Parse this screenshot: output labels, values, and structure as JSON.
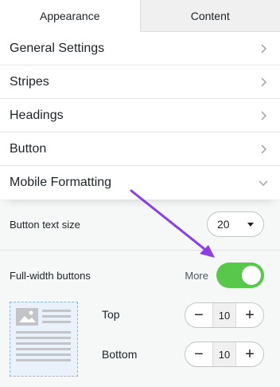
{
  "tabs": [
    {
      "label": "Appearance",
      "active": true
    },
    {
      "label": "Content",
      "active": false
    }
  ],
  "sections": [
    {
      "label": "General Settings",
      "state": "collapsed"
    },
    {
      "label": "Stripes",
      "state": "collapsed"
    },
    {
      "label": "Headings",
      "state": "collapsed"
    },
    {
      "label": "Button",
      "state": "collapsed"
    },
    {
      "label": "Mobile Formatting",
      "state": "expanded"
    }
  ],
  "mobile": {
    "button_text_size": {
      "label": "Button text size",
      "value": "20"
    },
    "full_width": {
      "label": "Full-width buttons",
      "more_label": "More",
      "enabled": true
    },
    "padding": {
      "top": {
        "label": "Top",
        "value": "10"
      },
      "bottom": {
        "label": "Bottom",
        "value": "10"
      }
    }
  },
  "icons": {
    "collapsed": "chevron-right-icon",
    "expanded": "chevron-down-icon",
    "minus": "−",
    "plus": "+"
  },
  "colors": {
    "toggle_on": "#58c84b",
    "annotation_arrow": "#8b3fe6",
    "panel_bg": "#f6f7f7"
  }
}
